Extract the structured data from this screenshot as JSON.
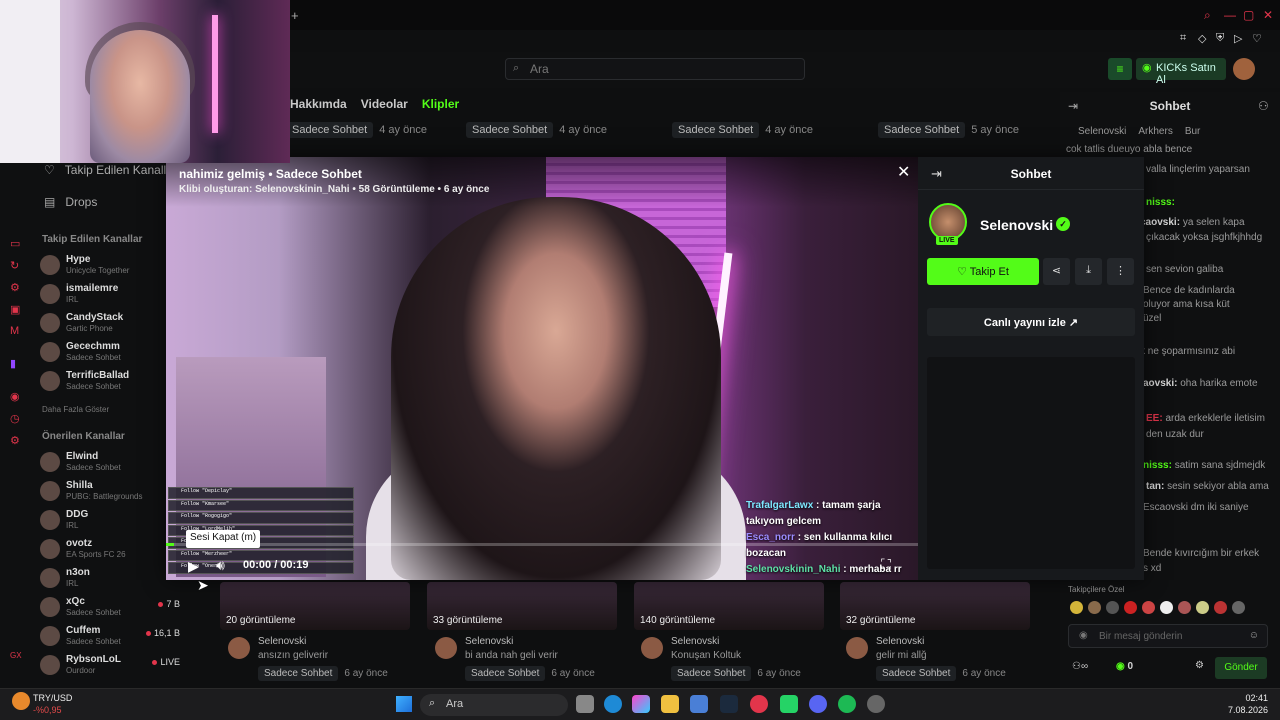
{
  "nav": {
    "search_placeholder": "Ara",
    "kicks_label": "KICKs Satın Al",
    "profile_tabs": [
      "Hakkımda",
      "Videolar",
      "Klipler"
    ]
  },
  "clip_row_top": [
    {
      "label": "Sadece Sohbet",
      "age": "4 ay önce"
    },
    {
      "label": "Sadece Sohbet",
      "age": "4 ay önce"
    },
    {
      "label": "Sadece Sohbet",
      "age": "4 ay önce"
    },
    {
      "label": "Sadece Sohbet",
      "age": "4 ay önce"
    },
    {
      "label": "Sadece Sohbet",
      "age": "5 ay önce"
    }
  ],
  "sidebar": {
    "nav": [
      {
        "label": "Takip Edilen Kanallar",
        "icon": "heart-icon"
      },
      {
        "label": "Drops",
        "icon": "drops-icon"
      }
    ],
    "followed_title": "Takip Edilen Kanallar",
    "followed": [
      {
        "name": "Hype",
        "category": "Unicycle Together",
        "viewers": ""
      },
      {
        "name": "ismailemre",
        "category": "IRL",
        "viewers": ""
      },
      {
        "name": "CandyStack",
        "category": "Gartic Phone",
        "viewers": ""
      },
      {
        "name": "Gecechmm",
        "category": "Sadece Sohbet",
        "viewers": ""
      },
      {
        "name": "TerrificBallad",
        "category": "Sadece Sohbet",
        "viewers": ""
      }
    ],
    "show_more": "Daha Fazla Göster",
    "recommended_title": "Önerilen Kanallar",
    "recommended": [
      {
        "name": "Elwind",
        "category": "Sadece Sohbet",
        "viewers": ""
      },
      {
        "name": "Shilla",
        "category": "PUBG: Battlegrounds",
        "viewers": ""
      },
      {
        "name": "DDG",
        "category": "IRL",
        "viewers": ""
      },
      {
        "name": "ovotz",
        "category": "EA Sports FC 26",
        "viewers": ""
      },
      {
        "name": "n3on",
        "category": "IRL",
        "viewers": ""
      },
      {
        "name": "xQc",
        "category": "Sadece Sohbet",
        "viewers": "7 B"
      },
      {
        "name": "Cuffem",
        "category": "Sadece Sohbet",
        "viewers": "16,1 B"
      },
      {
        "name": "RybsonLoL",
        "category": "Ourdoor",
        "viewers": "LIVE"
      }
    ]
  },
  "clip_cards": [
    {
      "views": "20 görüntüleme",
      "channel": "Selenovski",
      "title": "ansızın geliverir",
      "category": "Sadece Sohbet",
      "age": "6 ay önce"
    },
    {
      "views": "33 görüntüleme",
      "channel": "Selenovski",
      "title": "bi anda nah geli verir",
      "category": "Sadece Sohbet",
      "age": "6 ay önce"
    },
    {
      "views": "140 görüntüleme",
      "channel": "Selenovski",
      "title": "Konuşan Koltuk",
      "category": "Sadece Sohbet",
      "age": "6 ay önce"
    },
    {
      "views": "32 görüntüleme",
      "channel": "Selenovski",
      "title": "gelir mi allğ",
      "category": "Sadece Sohbet",
      "age": "6 ay önce"
    }
  ],
  "bg_chat": {
    "title": "Sohbet",
    "subs": [
      "Selenovski",
      "Arkhers",
      "Bur"
    ],
    "lines": [
      {
        "user": "",
        "text": "cok tatlis dueuyo abla bence",
        "color": ""
      },
      {
        "user": "",
        "text": "valla linçlerim yaparsan",
        "color": ""
      },
      {
        "user": "nisss:",
        "text": "",
        "color": "g"
      },
      {
        "user": "caovski:",
        "text": "ya selen kapa",
        "color": ""
      },
      {
        "user": "",
        "text": "çıkacak yoksa jsghfkjhhdg",
        "color": ""
      },
      {
        "user": "",
        "text": "sen sevion galiba",
        "color": ""
      },
      {
        "user": "",
        "text": "Bence de kadınlarda",
        "color": ""
      },
      {
        "user": "",
        "text": "oluyor ama kısa küt",
        "color": ""
      },
      {
        "user": "",
        "text": "üzel",
        "color": ""
      },
      {
        "user": "",
        "text": "k ne şoparmısınız abi",
        "color": ""
      },
      {
        "user": "aovski:",
        "text": "oha harika emote",
        "color": ""
      },
      {
        "user": "EE:",
        "text": "arda erkeklerle iletisim",
        "color": "r"
      },
      {
        "user": "",
        "text": "den uzak dur",
        "color": ""
      },
      {
        "user": "nisss:",
        "text": "satim sana sjdmejdk",
        "color": "g"
      },
      {
        "user": "tan:",
        "text": "sesin sekiyor abla ama",
        "color": ""
      },
      {
        "user": "",
        "text": "Escaovski dm iki saniye",
        "color": ""
      },
      {
        "user": "",
        "text": "Bende kıvırcığım bir erkek",
        "color": ""
      },
      {
        "user": "",
        "text": "s xd",
        "color": ""
      }
    ],
    "supporters_label": "Takipçilere Özel",
    "input_placeholder": "Bir mesaj gönderin",
    "kicks_count": "0",
    "send_label": "Gönder"
  },
  "modal": {
    "title": "nahimiz gelmiş • Sadece Sohbet",
    "meta": "Klibi oluşturan: Selenovskinin_Nahi • 58 Görüntüleme • 6 ay önce",
    "overlay_lines": [
      "Follow \"Depiclay\"",
      "Follow \"Kmarsee\"",
      "Follow \"Rogogigo\"",
      "Follow \"LordMelih\"",
      "Follow \"Sinolf3\"",
      "Follow \"Merzheer\"",
      "Follow \"Oner\""
    ],
    "stream_chat": [
      {
        "user": "TrafalgarLawx",
        "text": ": tamam şarja takıyom gelcem",
        "cls": "u1"
      },
      {
        "user": "Esca_norr",
        "text": ": sen kullanma kılıcı bozacan",
        "cls": "u2"
      },
      {
        "user": "Selenovskinin_Nahi",
        "text": ": merhaba rr",
        "cls": "u3"
      }
    ],
    "tooltip": "Sesi Kapat (m)",
    "time": "00:00 / 00:19",
    "progress": 0.01
  },
  "panel": {
    "title": "Sohbet",
    "channel": "Selenovski",
    "live_badge": "LIVE",
    "follow_label": "Takip Et",
    "watch_label": "Canlı yayını izle"
  },
  "taskbar": {
    "ticker_name": "TRY/USD",
    "ticker_change": "-%0,95",
    "search": "Ara",
    "time": "02:41",
    "date": "7.08.2026",
    "accent": "#53fc18"
  }
}
